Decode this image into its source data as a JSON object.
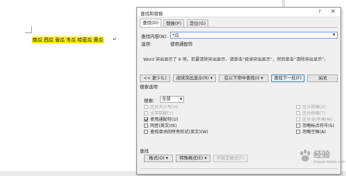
{
  "document": {
    "text": "南瓜 西瓜 香瓜 冬瓜 哈密瓜 黄瓜",
    "pilcrow": "↵",
    "highlight_color": "#ffee00"
  },
  "dialog": {
    "title": "查找和替换",
    "help_label": "?",
    "close_label": "✕",
    "tabs": [
      {
        "label": "查找(D)",
        "active": true
      },
      {
        "label": "替换(P)",
        "active": false
      },
      {
        "label": "定位(G)",
        "active": false
      }
    ],
    "find_label": "查找内容(N):",
    "find_value": "*瓜",
    "options_label": "选项:",
    "options_value": "使用通配符",
    "info_text": "Word 突出显示了 6 项。若要清除突出显示，请单击“阅读突出显示”，然后单击“清除突出显示”。",
    "buttons": {
      "less": "<< 更少(L)",
      "reading_highlight": "阅读突出显示(R) ▾",
      "find_in": "在以下项中查找(I) ▾",
      "find_next": "查找下一处(F)",
      "close": "关闭"
    },
    "search_options": {
      "section_title": "搜索选项",
      "search_label": "搜索:",
      "search_value": "全部",
      "left": [
        {
          "label": "区分大小写(H)",
          "checked": false,
          "disabled": true
        },
        {
          "label": "全字匹配(Y)",
          "checked": false,
          "disabled": true
        },
        {
          "label": "使用通配符(U)",
          "checked": true,
          "disabled": false
        },
        {
          "label": "同音(英文)(K)",
          "checked": false,
          "disabled": false
        },
        {
          "label": "查找单词的所有形式(英文)(W)",
          "checked": false,
          "disabled": false
        }
      ],
      "right": [
        {
          "label": "区分前缀(X)",
          "checked": false,
          "disabled": true
        },
        {
          "label": "区分后缀(T)",
          "checked": false,
          "disabled": true
        },
        {
          "label": "区分全/半角(M)",
          "checked": false,
          "disabled": true
        },
        {
          "label": "忽略标点符号(S)",
          "checked": false,
          "disabled": false
        },
        {
          "label": "忽略空格(A)",
          "checked": false,
          "disabled": false
        }
      ]
    },
    "find_section": {
      "title": "查找",
      "format_button": "格式(O) ▾",
      "special_button": "特殊格式(E) ▾",
      "no_format_button": "不限定格式(T)"
    }
  },
  "watermark": {
    "text": "经验",
    "sub": "jingyan.baidu.com"
  }
}
